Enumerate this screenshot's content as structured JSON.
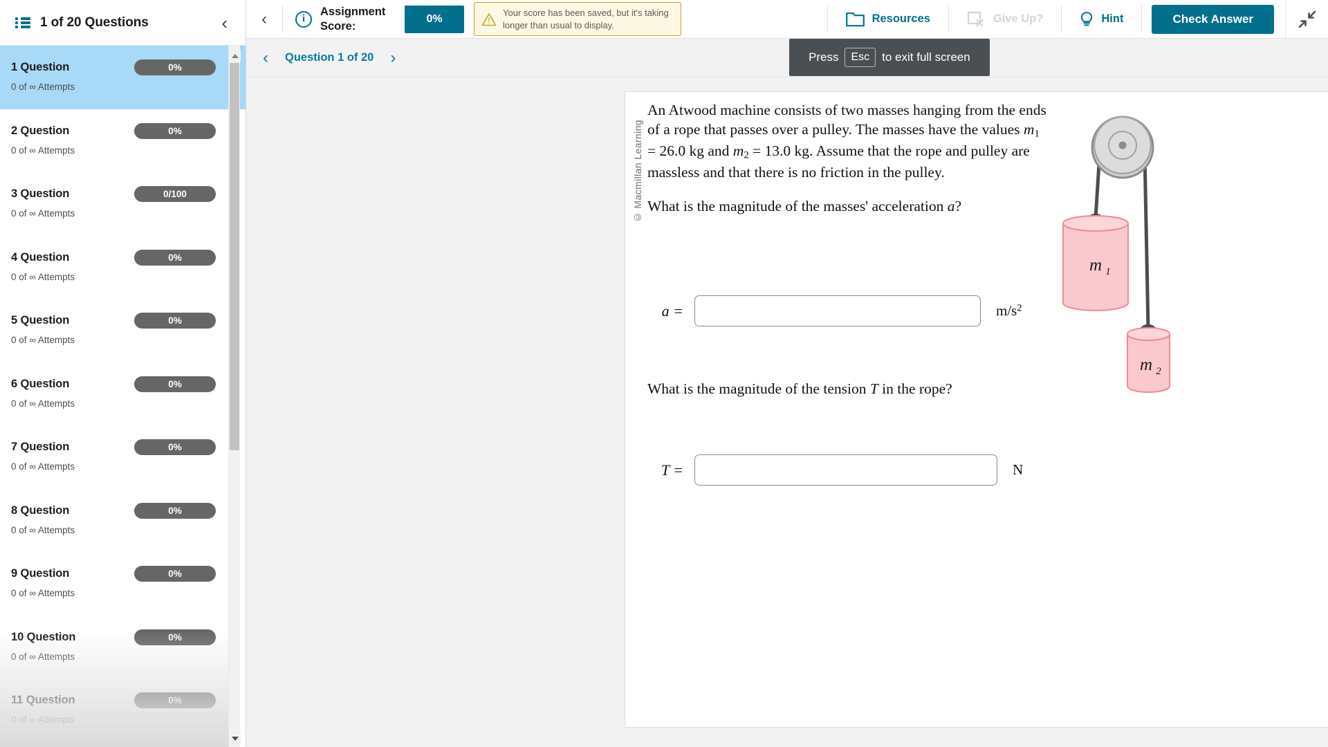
{
  "sidebar": {
    "header": {
      "icon": "list-icon",
      "title": "1 of 20 Questions",
      "collapse_icon": "chevron-left-icon"
    },
    "questions": [
      {
        "name": "1 Question",
        "badge": "0%",
        "attempts": "0 of ∞ Attempts",
        "active": true
      },
      {
        "name": "2 Question",
        "badge": "0%",
        "attempts": "0 of ∞ Attempts",
        "active": false
      },
      {
        "name": "3 Question",
        "badge": "0/100",
        "attempts": "0 of ∞ Attempts",
        "active": false
      },
      {
        "name": "4 Question",
        "badge": "0%",
        "attempts": "0 of ∞ Attempts",
        "active": false
      },
      {
        "name": "5 Question",
        "badge": "0%",
        "attempts": "0 of ∞ Attempts",
        "active": false
      },
      {
        "name": "6 Question",
        "badge": "0%",
        "attempts": "0 of ∞ Attempts",
        "active": false
      },
      {
        "name": "7 Question",
        "badge": "0%",
        "attempts": "0 of ∞ Attempts",
        "active": false
      },
      {
        "name": "8 Question",
        "badge": "0%",
        "attempts": "0 of ∞ Attempts",
        "active": false
      },
      {
        "name": "9 Question",
        "badge": "0%",
        "attempts": "0 of ∞ Attempts",
        "active": false
      },
      {
        "name": "10 Question",
        "badge": "0%",
        "attempts": "0 of ∞ Attempts",
        "active": false
      },
      {
        "name": "11 Question",
        "badge": "0%",
        "attempts": "0 of ∞ Attempts",
        "active": false
      }
    ]
  },
  "toolbar": {
    "back_icon": "chevron-left-icon",
    "info_icon": "info-circle-icon",
    "score_label": "Assignment Score:",
    "score_value": "0%",
    "warning": {
      "icon": "warning-triangle-icon",
      "text": "Your score has been saved, but it's taking longer than usual to display."
    },
    "resources_label": "Resources",
    "give_up_label": "Give Up?",
    "give_up_disabled": true,
    "hint_label": "Hint",
    "check_answer_label": "Check Answer",
    "fullscreen_icon": "exit-fullscreen-icon"
  },
  "tooltip": {
    "prefix": "Press",
    "key": "Esc",
    "suffix": "to exit full screen"
  },
  "question_nav": {
    "prev_icon": "chevron-left-icon",
    "label": "Question 1 of 20",
    "next_icon": "chevron-right-icon"
  },
  "question": {
    "copyright": "© Macmillan Learning",
    "body_part1": "An Atwood machine consists of two masses hanging from the ends of a rope that passes over a pulley. The masses have the values ",
    "m1_symbol": "m",
    "m1_sub": "1",
    "m1_value": " = 26.0 kg and ",
    "m2_symbol": "m",
    "m2_sub": "2",
    "m2_value": " = 13.0 kg. Assume that the rope and pulley are massless and that there is no friction in the pulley.",
    "prompt_a": "What is the magnitude of the masses' acceleration ",
    "prompt_a_var": "a",
    "prompt_a_end": "?",
    "prompt_t": "What is the magnitude of the tension ",
    "prompt_t_var": "T",
    "prompt_t_end": " in the rope?",
    "answer_a": {
      "label": "a =",
      "value": "",
      "unit_base": "m/s",
      "unit_exp": "2"
    },
    "answer_t": {
      "label": "T =",
      "value": "",
      "unit": "N"
    },
    "diagram": {
      "name": "atwood-machine-diagram",
      "mass1_label": "m",
      "mass1_sub": "1",
      "mass2_label": "m",
      "mass2_sub": "2",
      "mass_fill": "#f9c9ce",
      "mass_stroke": "#ef8a92",
      "rope_color": "#4d4d4d",
      "pulley_fill": "#d9d9d9",
      "pulley_stroke": "#8c8c8c"
    }
  },
  "colors": {
    "teal": "#00708c",
    "active_row": "#a8d9f7",
    "badge_gray": "#666666",
    "warning_bg": "#fcf8e3",
    "warning_border": "#c9a227",
    "tooltip_bg": "#4a4f54"
  }
}
